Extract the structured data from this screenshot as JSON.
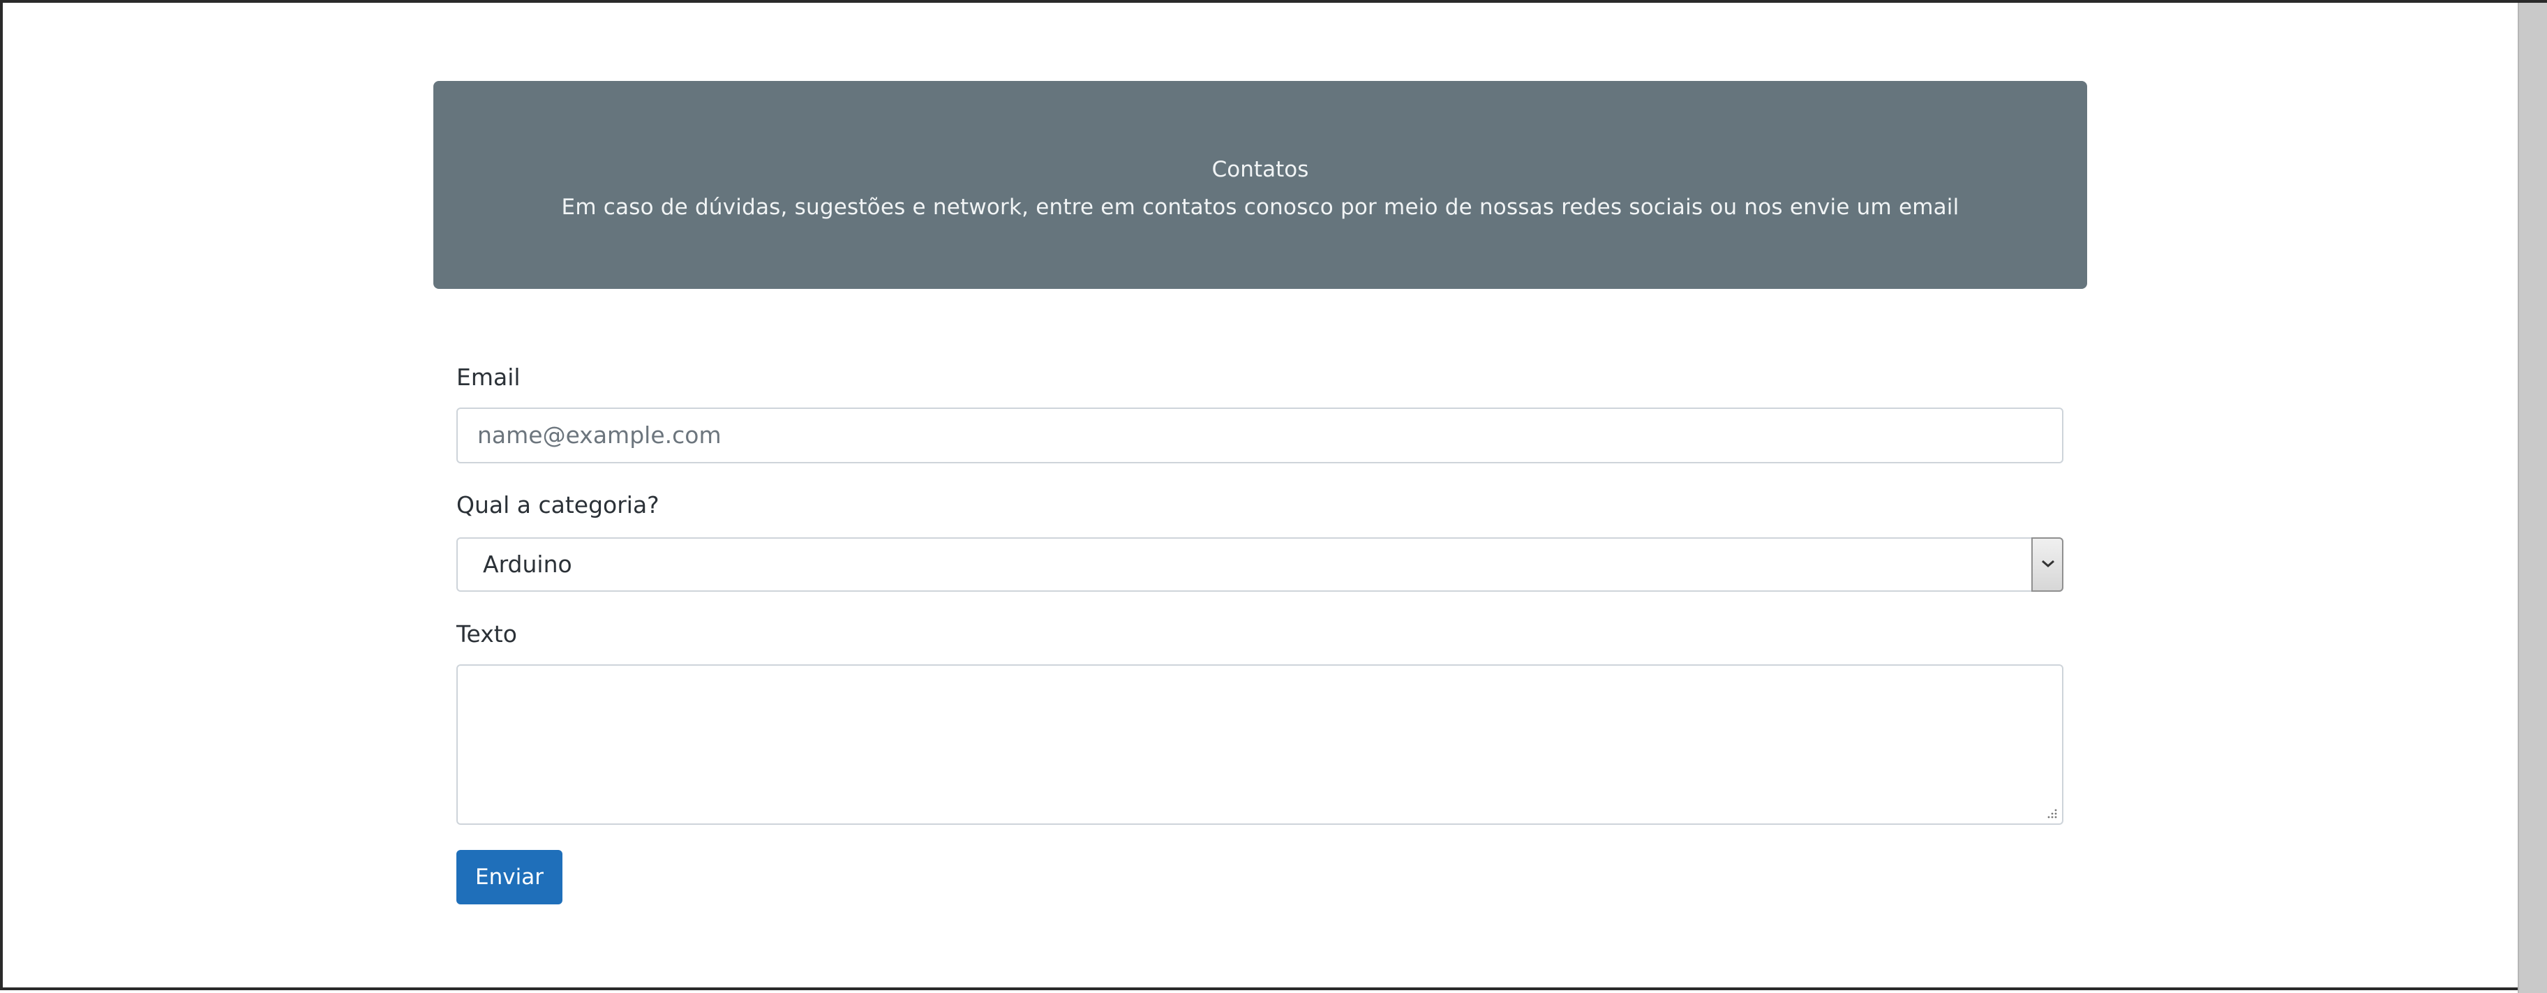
{
  "hero": {
    "title": "Contatos",
    "description": "Em caso de dúvidas, sugestões e network, entre em contatos conosco por meio de nossas redes sociais ou nos envie um email"
  },
  "form": {
    "email_label": "Email",
    "email_placeholder": "name@example.com",
    "email_value": "",
    "category_label": "Qual a categoria?",
    "category_selected": "Arduino",
    "text_label": "Texto",
    "text_value": "",
    "submit_label": "Enviar"
  },
  "colors": {
    "hero_bg": "#66757d",
    "button_bg": "#1f6fba"
  },
  "icons": {
    "select_arrow": "chevron-down-icon",
    "resize": "resize-grip-icon"
  }
}
